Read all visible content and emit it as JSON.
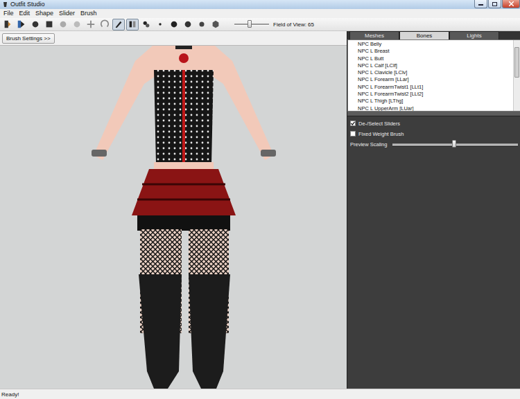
{
  "window": {
    "title": "Outfit Studio"
  },
  "menu": [
    "File",
    "Edit",
    "Shape",
    "Slider",
    "Brush"
  ],
  "toolbar": {
    "tools": [
      {
        "selected": false
      },
      {
        "selected": false
      },
      {
        "selected": false
      },
      {
        "selected": false
      },
      {
        "selected": false
      },
      {
        "selected": false
      },
      {
        "selected": false
      },
      {
        "selected": false
      },
      {
        "selected": true
      },
      {
        "selected": true
      },
      {
        "selected": false
      },
      {
        "selected": false
      },
      {
        "selected": false
      },
      {
        "selected": false
      },
      {
        "selected": false
      },
      {
        "selected": false
      }
    ],
    "fov": {
      "label": "Field of View: 65",
      "level": 0.44
    }
  },
  "brush_settings": "Brush Settings >>",
  "tabs": [
    {
      "label": "Meshes",
      "selected": false
    },
    {
      "label": "Bones",
      "selected": true
    },
    {
      "label": "Lights",
      "selected": false
    }
  ],
  "bones": [
    "NPC Belly",
    "NPC L Breast",
    "NPC L Butt",
    "NPC L Calf [LClf]",
    "NPC L Clavicle [LClv]",
    "NPC L Forearm [LLar]",
    "NPC L ForearmTwist1 [LLt1]",
    "NPC L ForearmTwist2 [LLt2]",
    "NPC L Thigh [LThg]",
    "NPC L UpperArm [LUar]"
  ],
  "options": [
    {
      "kind": "checkbox",
      "label": "De-/Select Sliders",
      "checked": true
    },
    {
      "kind": "checkbox",
      "label": "Fixed Weight Brush",
      "checked": false
    },
    {
      "kind": "slider",
      "label": "Preview Scaling",
      "level": 0.49
    }
  ],
  "status_bar": "Ready!"
}
